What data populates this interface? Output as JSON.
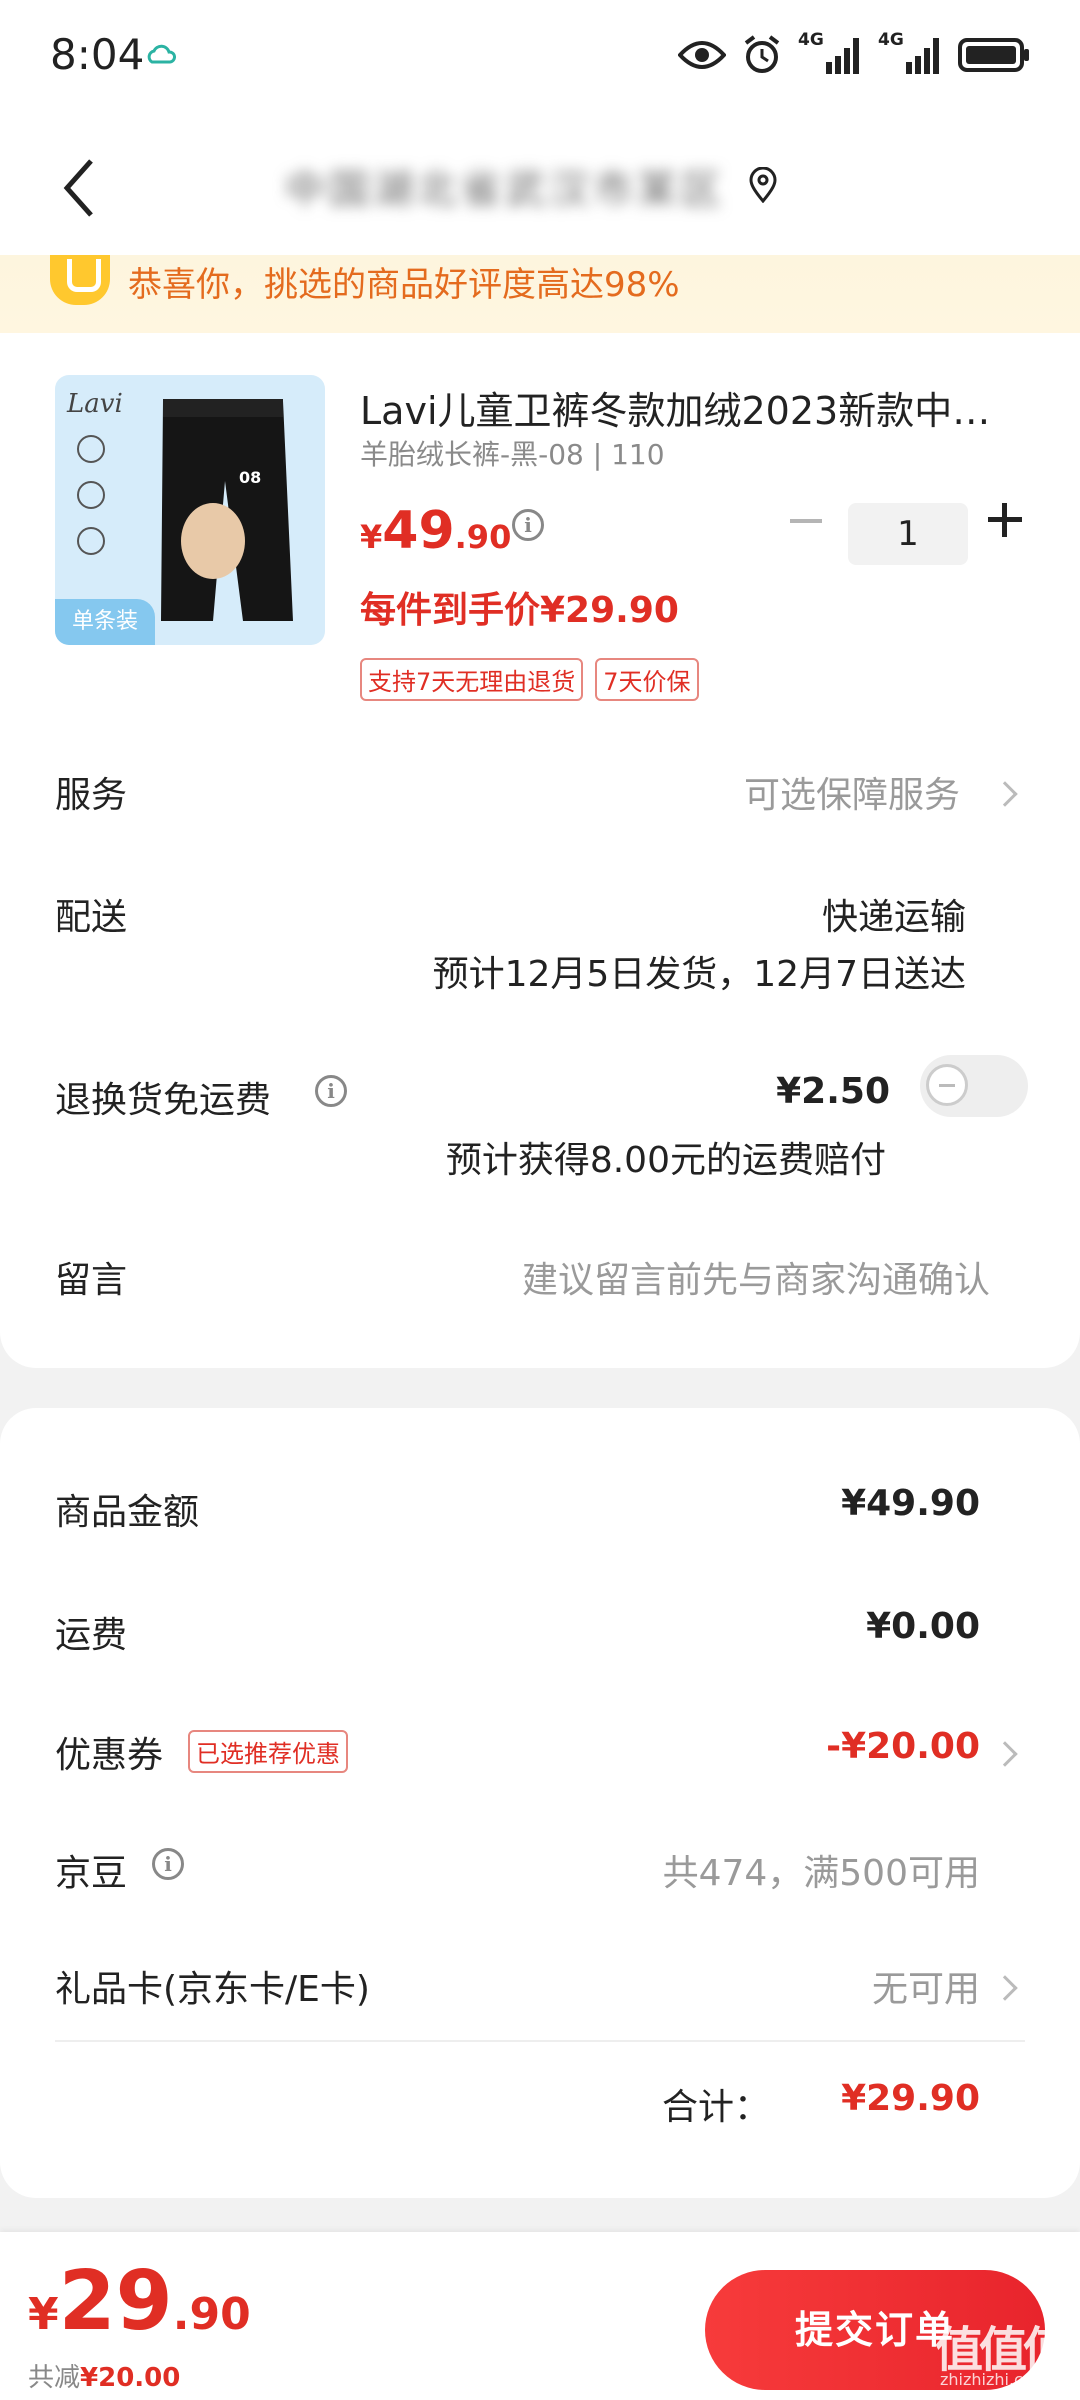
{
  "status_bar": {
    "time": "8:04",
    "net1": "4G",
    "net2": "4G"
  },
  "header": {
    "address_blurred": "中国湖北省武汉市某区",
    "accent": "#e02e24"
  },
  "banner": {
    "text": "恭喜你，挑选的商品好评度高达98%"
  },
  "product": {
    "brand": "Lavi",
    "image_badge": "单条装",
    "title": "Lavi儿童卫裤冬款加绒2023新款中…",
    "spec": "羊胎绒长裤-黑-08 | 110",
    "price_currency": "¥",
    "price_int": "49",
    "price_dec": ".90",
    "quantity": "1",
    "per_price": "每件到手价¥29.90",
    "tags": [
      "支持7天无理由退货",
      "7天价保"
    ]
  },
  "service": {
    "label": "服务",
    "value": "可选保障服务"
  },
  "delivery": {
    "label": "配送",
    "method": "快递运输",
    "eta": "预计12月5日发货，12月7日送达"
  },
  "return_insurance": {
    "label": "退换货免运费",
    "price": "¥2.50",
    "note": "预计获得8.00元的运费赔付",
    "enabled": false
  },
  "message": {
    "label": "留言",
    "placeholder": "建议留言前先与商家沟通确认"
  },
  "summary": {
    "goods_label": "商品金额",
    "goods_value": "¥49.90",
    "shipping_label": "运费",
    "shipping_value": "¥0.00",
    "coupon_label": "优惠券",
    "coupon_tag": "已选推荐优惠",
    "coupon_value": "-¥20.00",
    "beans_label": "京豆",
    "beans_value": "共474，满500可用",
    "giftcard_label": "礼品卡(京东卡/E卡)",
    "giftcard_value": "无可用",
    "total_label": "合计：",
    "total_value": "¥29.90"
  },
  "bottom": {
    "currency": "¥",
    "total_int": "29",
    "total_dec": ".90",
    "saved_label": "共减",
    "saved_value": "¥20.00",
    "submit_label": "提交订单"
  },
  "watermark": {
    "text": "值值值",
    "sub": "zhizhizhi.com"
  }
}
